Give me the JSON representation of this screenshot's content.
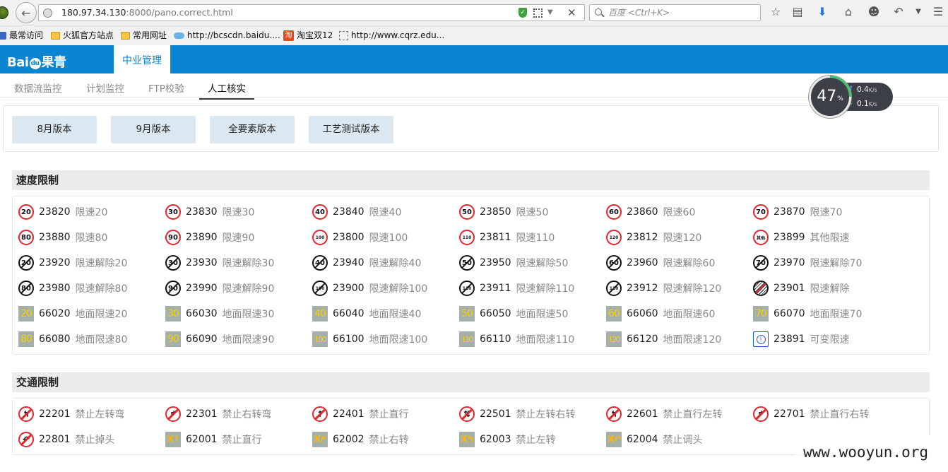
{
  "browser": {
    "url_host": "180.97.34.130",
    "url_rest": ":8000/pano.correct.html",
    "search_placeholder": "百度 <Ctrl+K>",
    "bookmarks": [
      {
        "label": "最常访问",
        "icon": "small-icon"
      },
      {
        "label": "火狐官方站点",
        "icon": "folder-icon"
      },
      {
        "label": "常用网址",
        "icon": "folder-icon"
      },
      {
        "label": "http://bcscdn.baidu....",
        "icon": "cloud-icon"
      },
      {
        "label": "淘宝双12",
        "icon": "taobao-icon",
        "glyph": "淘"
      },
      {
        "label": "http://www.cqrz.edu...",
        "icon": "page-icon"
      }
    ]
  },
  "header": {
    "logo": {
      "left": "Bai",
      "paw": "du",
      "right": "果青"
    },
    "nav_active": "中业管理"
  },
  "subnav": [
    {
      "label": "数据流监控",
      "active": false
    },
    {
      "label": "计划监控",
      "active": false
    },
    {
      "label": "FTP校验",
      "active": false
    },
    {
      "label": "人工核实",
      "active": true
    }
  ],
  "gauge": {
    "percent": "47",
    "percent_sign": "%",
    "up": "0.4",
    "down": "0.1",
    "unit": "K/s"
  },
  "versions": [
    "8月版本",
    "9月版本",
    "全要素版本",
    "工艺测试版本"
  ],
  "speed_section": {
    "title": "速度限制",
    "items": [
      {
        "kind": "limit",
        "glyph": "20",
        "code": "23820",
        "name": "限速20"
      },
      {
        "kind": "limit",
        "glyph": "30",
        "code": "23830",
        "name": "限速30"
      },
      {
        "kind": "limit",
        "glyph": "40",
        "code": "23840",
        "name": "限速40"
      },
      {
        "kind": "limit",
        "glyph": "50",
        "code": "23850",
        "name": "限速50"
      },
      {
        "kind": "limit",
        "glyph": "60",
        "code": "23860",
        "name": "限速60"
      },
      {
        "kind": "limit",
        "glyph": "70",
        "code": "23870",
        "name": "限速70"
      },
      {
        "kind": "limit",
        "glyph": "80",
        "code": "23880",
        "name": "限速80"
      },
      {
        "kind": "limit",
        "glyph": "90",
        "code": "23890",
        "name": "限速90"
      },
      {
        "kind": "limit",
        "glyph": "100",
        "code": "23800",
        "name": "限速100"
      },
      {
        "kind": "limit",
        "glyph": "110",
        "code": "23811",
        "name": "限速110"
      },
      {
        "kind": "limit",
        "glyph": "120",
        "code": "23812",
        "name": "限速120"
      },
      {
        "kind": "limit",
        "glyph": "其他",
        "code": "23899",
        "name": "其他限速"
      },
      {
        "kind": "end",
        "glyph": "20",
        "code": "23920",
        "name": "限速解除20"
      },
      {
        "kind": "end",
        "glyph": "30",
        "code": "23930",
        "name": "限速解除30"
      },
      {
        "kind": "end",
        "glyph": "40",
        "code": "23940",
        "name": "限速解除40"
      },
      {
        "kind": "end",
        "glyph": "50",
        "code": "23950",
        "name": "限速解除50"
      },
      {
        "kind": "end",
        "glyph": "60",
        "code": "23960",
        "name": "限速解除60"
      },
      {
        "kind": "end",
        "glyph": "70",
        "code": "23970",
        "name": "限速解除70"
      },
      {
        "kind": "end",
        "glyph": "80",
        "code": "23980",
        "name": "限速解除80"
      },
      {
        "kind": "end",
        "glyph": "90",
        "code": "23990",
        "name": "限速解除90"
      },
      {
        "kind": "end",
        "glyph": "100",
        "code": "23900",
        "name": "限速解除100"
      },
      {
        "kind": "end",
        "glyph": "110",
        "code": "23911",
        "name": "限速解除110"
      },
      {
        "kind": "end",
        "glyph": "120",
        "code": "23912",
        "name": "限速解除120"
      },
      {
        "kind": "endall",
        "glyph": "",
        "code": "23901",
        "name": "限速解除"
      },
      {
        "kind": "ground",
        "glyph": "20",
        "code": "66020",
        "name": "地面限速20"
      },
      {
        "kind": "ground",
        "glyph": "30",
        "code": "66030",
        "name": "地面限速30"
      },
      {
        "kind": "ground",
        "glyph": "40",
        "code": "66040",
        "name": "地面限速40"
      },
      {
        "kind": "ground",
        "glyph": "50",
        "code": "66050",
        "name": "地面限速50"
      },
      {
        "kind": "ground",
        "glyph": "60",
        "code": "66060",
        "name": "地面限速60"
      },
      {
        "kind": "ground",
        "glyph": "70",
        "code": "66070",
        "name": "地面限速70"
      },
      {
        "kind": "ground",
        "glyph": "80",
        "code": "66080",
        "name": "地面限速80"
      },
      {
        "kind": "ground",
        "glyph": "90",
        "code": "66090",
        "name": "地面限速90"
      },
      {
        "kind": "ground",
        "glyph": "100",
        "code": "66100",
        "name": "地面限速100"
      },
      {
        "kind": "ground",
        "glyph": "110",
        "code": "66110",
        "name": "地面限速110"
      },
      {
        "kind": "ground",
        "glyph": "120",
        "code": "66120",
        "name": "地面限速120"
      },
      {
        "kind": "variable",
        "glyph": "",
        "code": "23891",
        "name": "可变限速"
      }
    ]
  },
  "traffic_section": {
    "title": "交通限制",
    "items": [
      {
        "kind": "arrow",
        "glyph": "↰",
        "code": "22201",
        "name": "禁止左转弯"
      },
      {
        "kind": "arrow",
        "glyph": "↱",
        "code": "22301",
        "name": "禁止右转弯"
      },
      {
        "kind": "arrow",
        "glyph": "↑",
        "code": "22401",
        "name": "禁止直行"
      },
      {
        "kind": "arrow",
        "glyph": "⇅",
        "code": "22501",
        "name": "禁止左转右转"
      },
      {
        "kind": "arrow",
        "glyph": "↰",
        "code": "22601",
        "name": "禁止直行左转"
      },
      {
        "kind": "arrow",
        "glyph": "↱",
        "code": "22701",
        "name": "禁止直行右转"
      },
      {
        "kind": "arrow",
        "glyph": "↶",
        "code": "22801",
        "name": "禁止掉头"
      },
      {
        "kind": "lane",
        "glyph": "X↑",
        "code": "62001",
        "name": "禁止直行"
      },
      {
        "kind": "lane",
        "glyph": "X↱",
        "code": "62002",
        "name": "禁止右转"
      },
      {
        "kind": "lane",
        "glyph": "X↰",
        "code": "62003",
        "name": "禁止左转"
      },
      {
        "kind": "lane",
        "glyph": "X↶",
        "code": "62004",
        "name": "禁止调头"
      }
    ]
  },
  "watermark": "www.wooyun.org"
}
